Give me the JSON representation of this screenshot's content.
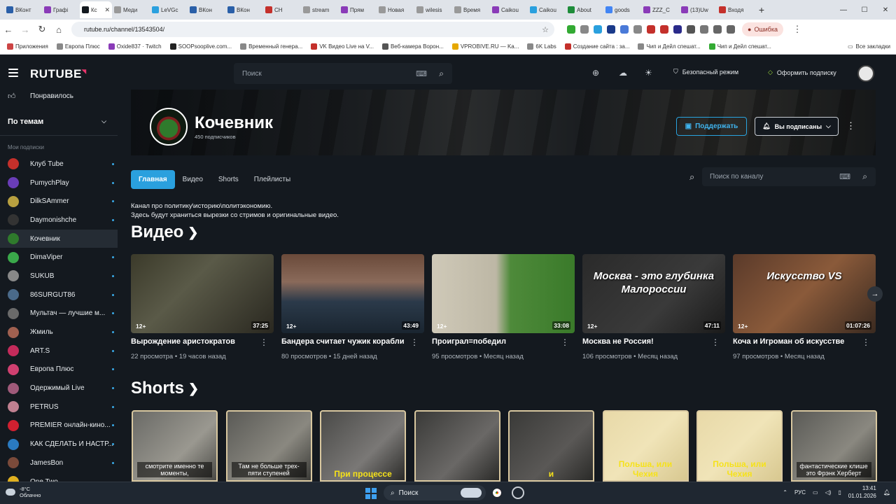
{
  "browser": {
    "tabs": [
      {
        "label": "ВКонт",
        "color": "#2a5fa8"
      },
      {
        "label": "Графі",
        "color": "#8a3bb8"
      },
      {
        "label": "Кc",
        "color": "#14191f",
        "active": true
      },
      {
        "label": "Меди",
        "color": "#999999"
      },
      {
        "label": "LeVGc",
        "color": "#2aa0de"
      },
      {
        "label": "ВКон",
        "color": "#2a5fa8"
      },
      {
        "label": "ВКон",
        "color": "#2a5fa8"
      },
      {
        "label": "CH",
        "color": "#c4302b"
      },
      {
        "label": "stream",
        "color": "#999999"
      },
      {
        "label": "Прям",
        "color": "#8a3bb8"
      },
      {
        "label": "Новая",
        "color": "#999999"
      },
      {
        "label": "wilesis",
        "color": "#999999"
      },
      {
        "label": "Время",
        "color": "#999999"
      },
      {
        "label": "Caikou",
        "color": "#8a3bb8"
      },
      {
        "label": "Caikou",
        "color": "#2aa0de"
      },
      {
        "label": "About",
        "color": "#1e8c3a"
      },
      {
        "label": "goods",
        "color": "#4285f4"
      },
      {
        "label": "ZZZ_C",
        "color": "#8a3bb8"
      },
      {
        "label": "(13)Uw",
        "color": "#8a3bb8"
      },
      {
        "label": "Входя",
        "color": "#c4302b"
      }
    ],
    "url": "rutube.ru/channel/13543504/",
    "error_label": "Ошибка",
    "bookmarks": [
      {
        "label": "Приложения",
        "color": "#c44"
      },
      {
        "label": "Европа Плюс",
        "color": "#888"
      },
      {
        "label": "Oxide837 · Twitch",
        "color": "#8a3bb8"
      },
      {
        "label": "SOOPsooplive.com...",
        "color": "#222"
      },
      {
        "label": "Временный генера...",
        "color": "#888"
      },
      {
        "label": "VK Видео Live на V...",
        "color": "#c4302b"
      },
      {
        "label": "Веб-камера Ворон...",
        "color": "#555"
      },
      {
        "label": "VPROBIVE.RU — Ka...",
        "color": "#e6a800"
      },
      {
        "label": "6K Labs",
        "color": "#888"
      },
      {
        "label": "Создание сайта : за...",
        "color": "#c4302b"
      },
      {
        "label": "Чип и Дейл спешат...",
        "color": "#888"
      },
      {
        "label": "Чип и Дейл спешат...",
        "color": "#3a3"
      }
    ],
    "all_bookmarks": "Все закладки"
  },
  "header": {
    "logo": "RUTUBE",
    "search_placeholder": "Поиск",
    "safe_mode": "Безопасный режим",
    "subscribe_cta": "Оформить подписку"
  },
  "sidebar": {
    "liked": "Понравилось",
    "topics": "По темам",
    "section": "Мои подписки",
    "items": [
      {
        "label": "Клуб Tube",
        "color": "#c4302b",
        "dot": true
      },
      {
        "label": "PumychPlay",
        "color": "#6a3db8",
        "dot": true
      },
      {
        "label": "DilkSAmmer",
        "color": "#b8a040",
        "dot": true
      },
      {
        "label": "Daymonishche",
        "color": "#333333",
        "dot": true
      },
      {
        "label": "Кочевник",
        "color": "#2f7a2c",
        "dot": false,
        "active": true
      },
      {
        "label": "DimaViper",
        "color": "#3aa84a",
        "dot": true
      },
      {
        "label": "SUKUB",
        "color": "#888888",
        "dot": true
      },
      {
        "label": "86SURGUT86",
        "color": "#4a6a8a",
        "dot": true
      },
      {
        "label": "Мультач — лучшие м...",
        "color": "#6a6a6a",
        "dot": true
      },
      {
        "label": "Жмиль",
        "color": "#a06050",
        "dot": true
      },
      {
        "label": "ART.S",
        "color": "#c42b5b",
        "dot": true
      },
      {
        "label": "Европа Плюс",
        "color": "#d04070",
        "dot": true
      },
      {
        "label": "Одержимый Live",
        "color": "#a05a7a",
        "dot": true
      },
      {
        "label": "PETRUS",
        "color": "#c08090",
        "dot": true
      },
      {
        "label": "PREMIER онлайн-кино...",
        "color": "#d02030",
        "dot": true
      },
      {
        "label": "КАК СДЕЛАТЬ И НАСТР...",
        "color": "#2a7ac0",
        "dot": true
      },
      {
        "label": "JamesBon",
        "color": "#7a4a3a",
        "dot": true
      },
      {
        "label": "One Two",
        "color": "#e0b020",
        "dot": false
      }
    ]
  },
  "channel": {
    "name": "Кочевник",
    "subscribers": "450 подписчиков",
    "support_label": "Поддержать",
    "subscribed_label": "Вы подписаны",
    "tabs": [
      "Главная",
      "Видео",
      "Shorts",
      "Плейлисты"
    ],
    "search_placeholder": "Поиск по каналу",
    "description_line1": "Канал про политику\\историю\\политэкономию.",
    "description_line2": "Здесь будут храниться вырезки со стримов и оригинальные видео."
  },
  "videos_section": "Видео",
  "videos": [
    {
      "title": "Вырождение аристократов",
      "views": "22 просмотра",
      "age": "19 часов назад",
      "rating": "12+",
      "duration": "37:25",
      "overlay": "",
      "bg": "linear-gradient(135deg,#3b3a2a,#5a5a48 40%,#2a2820)"
    },
    {
      "title": "Бандера считает чужик корабли",
      "views": "80 просмотров",
      "age": "15 дней назад",
      "rating": "12+",
      "duration": "43:49",
      "overlay": "",
      "bg": "linear-gradient(180deg,#6a4a3a 0%,#8a6a5a 35%,#2b3a4a 60%,#1a2530)"
    },
    {
      "title": "Проиграл=победил",
      "views": "95 просмотров",
      "age": "Месяц назад",
      "rating": "12+",
      "duration": "33:08",
      "overlay": "",
      "bg": "linear-gradient(90deg,#cfc9b8 0%,#bdb7a5 45%,#4e8a3a 55%,#3a7a2a 100%)"
    },
    {
      "title": "Москва не Россия!",
      "views": "106 просмотров",
      "age": "Месяц назад",
      "rating": "12+",
      "duration": "47:11",
      "overlay": "Москва - это глубинка Малороссии",
      "bg": "linear-gradient(135deg,#2a2a2a,#3a3a3a 60%,#1a1a1a)"
    },
    {
      "title": "Коча и Игроман об искусстве",
      "views": "97 просмотров",
      "age": "Месяц назад",
      "rating": "12+",
      "duration": "01:07:26",
      "overlay": "Искусство VS",
      "bg": "linear-gradient(135deg,#5a3a2a,#8a5a3a 50%,#3a2a20)"
    }
  ],
  "shorts_section": "Shorts",
  "shorts": [
    {
      "caption": "смотрите именно те моменты,",
      "style": "white",
      "bg": "linear-gradient(135deg,#6a6a66,#9a9890 60%,#4a4a46)"
    },
    {
      "caption": "Там не больше трех-пяти ступеней",
      "style": "white",
      "bg": "linear-gradient(135deg,#5a5a56,#8a8880 60%,#3a3a36)"
    },
    {
      "caption": "При процессе",
      "style": "yellow",
      "bg": "linear-gradient(135deg,#4a4a48,#7a7876 60%,#2a2a28)"
    },
    {
      "caption": "",
      "style": "white",
      "bg": "linear-gradient(135deg,#3a3a38,#6a6866 60%,#2a2a28)"
    },
    {
      "caption": "и",
      "style": "yellow",
      "bg": "linear-gradient(135deg,#3a3a38,#5a5856 60%,#2a2a28)"
    },
    {
      "caption": "Польша, или Чехия",
      "style": "yellow",
      "bg": "linear-gradient(135deg,#e8d9a8,#f0e4b8 50%,#d8c890)"
    },
    {
      "caption": "Польша, или Чехия",
      "style": "yellow",
      "bg": "linear-gradient(135deg,#e8d9a8,#f0e4b8 50%,#d8c890)"
    },
    {
      "caption": "фантастические клише это Фрэнк Херберт",
      "style": "white",
      "bg": "linear-gradient(135deg,#5a5a56,#8a8880 60%,#3a3a36)"
    }
  ],
  "taskbar": {
    "temp": "-8°C",
    "weather": "Облачно",
    "search": "Поиск",
    "lang": "РУС",
    "time": "13:41",
    "date": "01.01.2026"
  }
}
